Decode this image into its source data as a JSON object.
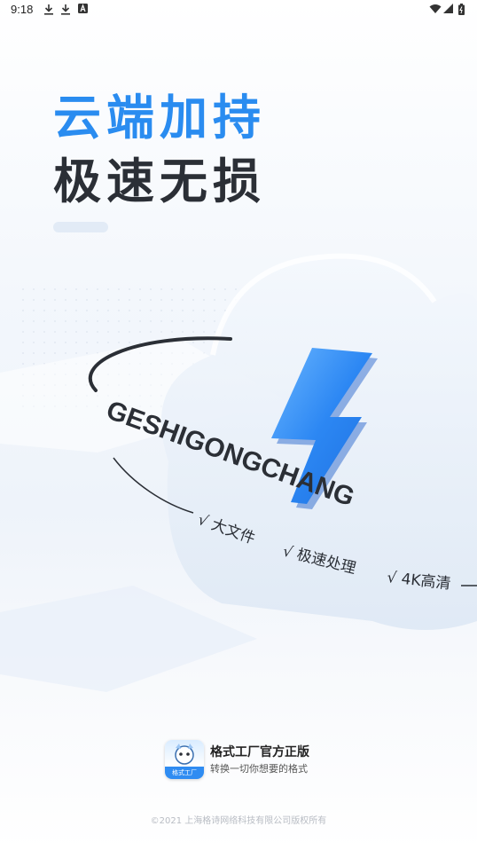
{
  "status_bar": {
    "time": "9:18",
    "left_icons": [
      "download-icon",
      "download-icon",
      "notification-a-icon"
    ],
    "right_icons": [
      "wifi-icon",
      "signal-icon",
      "battery-icon"
    ]
  },
  "headline": {
    "line1": "云端加持",
    "line2": "极速无损",
    "line1_color": "#2a8cf0",
    "line2_color": "#2b2f36"
  },
  "illustration": {
    "ring_text": "GESHIGONGCHANG",
    "features": [
      "√ 大文件",
      "√ 极速处理",
      "√ 4K高清"
    ],
    "icon": "lightning-bolt-icon"
  },
  "brand": {
    "app_name": "格式工厂官方正版",
    "slogan": "转换一切你想要的格式",
    "logo_label": "格式工厂"
  },
  "footer": {
    "copyright": "©2021 上海格诗网络科技有限公司版权所有"
  }
}
